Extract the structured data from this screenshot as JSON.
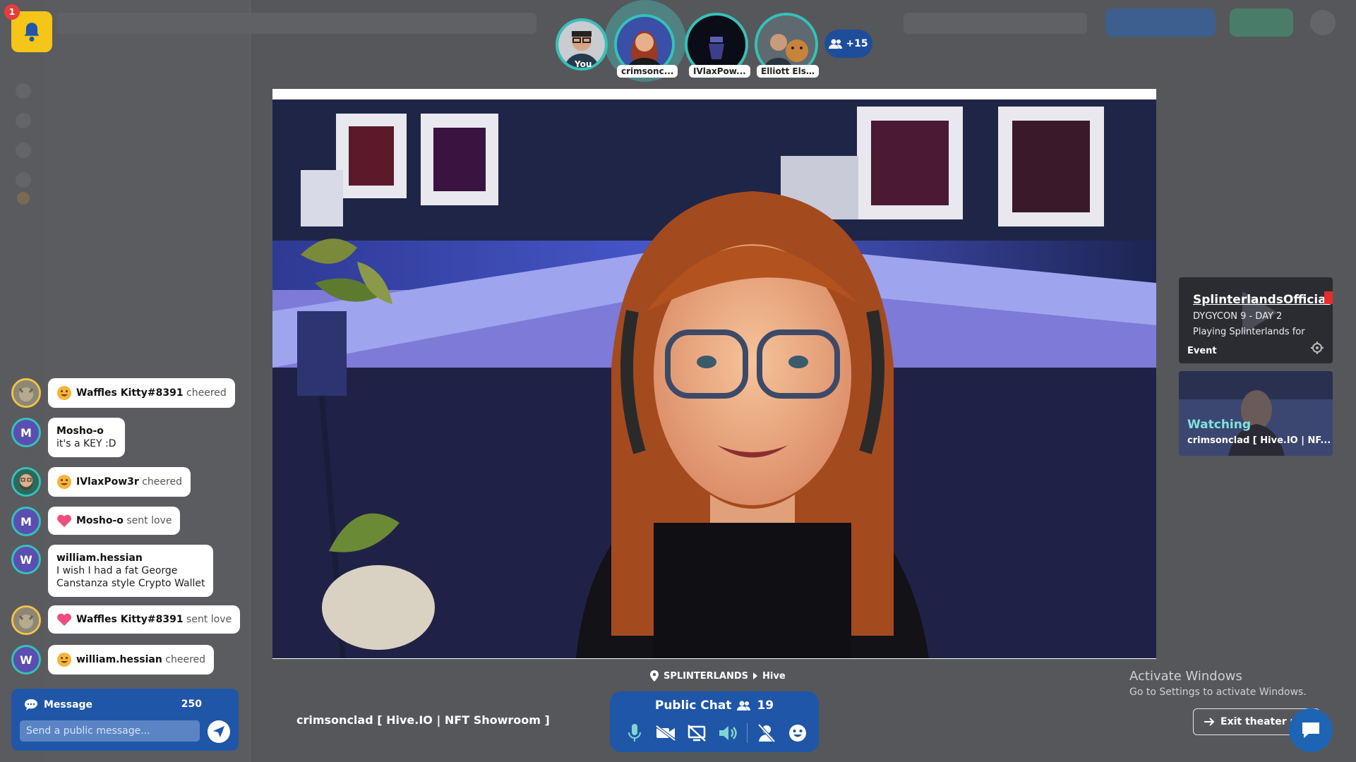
{
  "notifications": {
    "badge_count": "1"
  },
  "participants": {
    "items": [
      {
        "label": "You"
      },
      {
        "label": "crimsonc..."
      },
      {
        "label": "IVlaxPow..."
      },
      {
        "label": "Elliott Els..."
      }
    ],
    "more_label": "+15"
  },
  "chat_feed": {
    "items": [
      {
        "user": "Waffles Kitty#8391",
        "action": "cheered"
      },
      {
        "user": "Mosho-o",
        "message": "it's a KEY :D",
        "avatar_letter": "M"
      },
      {
        "user": "IVlaxPow3r",
        "action": "cheered"
      },
      {
        "user": "Mosho-o",
        "action": "sent love",
        "avatar_letter": "M"
      },
      {
        "user": "william.hessian",
        "message_line1": "I wish I had a fat George",
        "message_line2": "Canstanza style Crypto Wallet",
        "avatar_letter": "W"
      },
      {
        "user": "Waffles Kitty#8391",
        "action": "sent love"
      },
      {
        "user": "william.hessian",
        "action": "cheered",
        "avatar_letter": "W"
      }
    ]
  },
  "message_box": {
    "label": "Message",
    "char_count": "250",
    "placeholder": "Send a public message..."
  },
  "location": {
    "group": "SPLINTERLANDS",
    "room": "Hive"
  },
  "room_title": "crimsonclad [ Hive.IO | NFT Showroom ]",
  "public_chat": {
    "label": "Public Chat",
    "count": "19"
  },
  "event_card": {
    "name": "SplinterlandsOfficial",
    "line1": "DYGYCON 9 - DAY 2",
    "line2": "Playing Splinterlands for",
    "kind": "Event"
  },
  "watching_card": {
    "label": "Watching",
    "title": "crimsonclad [ Hive.IO | NF..."
  },
  "windows_watermark": {
    "line1": "Activate Windows",
    "line2": "Go to Settings to activate Windows."
  },
  "exit_theater_label": "Exit theater mo",
  "colors": {
    "accent_teal": "#35c1b8",
    "primary_blue": "#1f56a8",
    "notification_yellow": "#f5c518"
  }
}
